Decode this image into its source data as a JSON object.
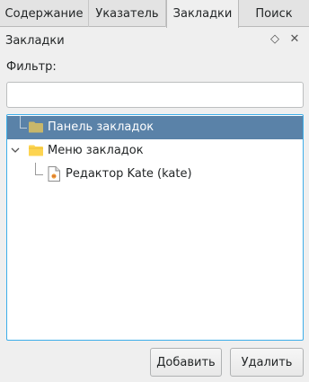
{
  "tabs": [
    {
      "label": "Содержание"
    },
    {
      "label": "Указатель"
    },
    {
      "label": "Закладки"
    },
    {
      "label": "Поиск"
    }
  ],
  "panel": {
    "title": "Закладки",
    "float_icon": "◇",
    "close_icon": "✕"
  },
  "filter": {
    "label": "Фильтр:",
    "value": "",
    "placeholder": ""
  },
  "tree": {
    "items": [
      {
        "label": "Панель закладок",
        "icon": "folder-icon",
        "selected": true
      },
      {
        "label": "Меню закладок",
        "icon": "folder-icon",
        "expanded": true
      },
      {
        "label": "Редактор Kate (kate)",
        "icon": "document-icon"
      }
    ]
  },
  "buttons": {
    "add": "Добавить",
    "remove": "Удалить"
  },
  "colors": {
    "selection": "#5a82a8",
    "focus_border": "#3daee9",
    "folder_selected": "#c8b76a",
    "folder": "#fdd451"
  }
}
